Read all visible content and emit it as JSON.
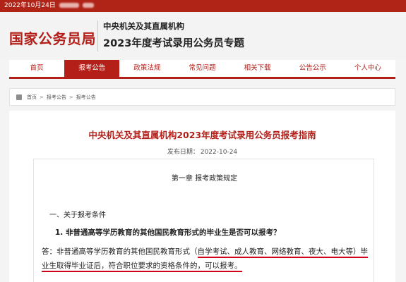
{
  "topbar": {
    "date_text": "2022年10月24日"
  },
  "header": {
    "logo": "国家公务员局",
    "subtitle_line1": "中央机关及其直属机构",
    "subtitle_line2": "2023年度考试录用公务员专题"
  },
  "nav": {
    "items": [
      {
        "label": "首页",
        "active": false
      },
      {
        "label": "报考公告",
        "active": true
      },
      {
        "label": "政策法规",
        "active": false
      },
      {
        "label": "常见问题",
        "active": false
      },
      {
        "label": "相关下载",
        "active": false
      },
      {
        "label": "公告公示",
        "active": false
      },
      {
        "label": "个人中心",
        "active": false
      }
    ]
  },
  "breadcrumb": {
    "items": [
      "首页",
      "报考公告",
      "报考公告"
    ],
    "separator": ">"
  },
  "article": {
    "title": "中央机关及其直属机构2023年度考试录用公务员报考指南",
    "date_label": "发布日期：",
    "date_value": "2022-10-24",
    "chapter": "第一章  报考政策规定",
    "section": "一、关于报考条件",
    "question": "1. 非普通高等学历教育的其他国民教育形式的毕业生是否可以报考？",
    "answer": {
      "part1": "答：非普通高等学历教育的其他国民教育形式（",
      "part2": "自学考试、成人教育、网络教育、夜大、电大等",
      "part3": "）毕业生取得毕业证后，符合职位要求的资格条件的，可以报考。"
    }
  },
  "colors": {
    "brand_red": "#b42019",
    "underline_red": "#d0021b",
    "page_bg": "#f4f4f4"
  }
}
